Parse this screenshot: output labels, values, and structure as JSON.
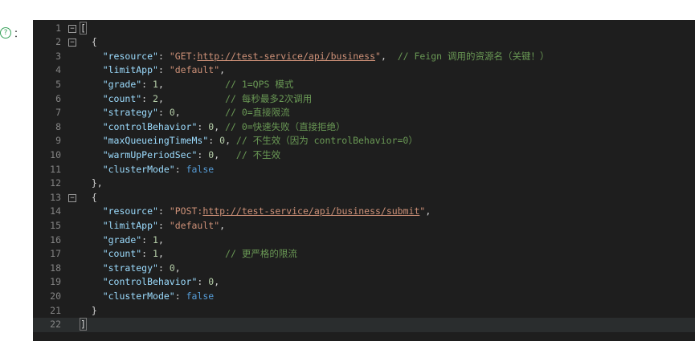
{
  "label": {
    "text": "："
  },
  "editor": {
    "lines": [
      {
        "n": "1",
        "fold": "⊟",
        "tokens": [
          {
            "t": "[",
            "c": "p bracket-box"
          }
        ]
      },
      {
        "n": "2",
        "fold": "⊟",
        "tokens": [
          {
            "t": "  {",
            "c": "p"
          }
        ]
      },
      {
        "n": "3",
        "tokens": [
          {
            "t": "    ",
            "c": "p"
          },
          {
            "t": "\"resource\"",
            "c": "k"
          },
          {
            "t": ": ",
            "c": "p"
          },
          {
            "t": "\"GET:",
            "c": "s"
          },
          {
            "t": "http://test-service/api/business",
            "c": "s u"
          },
          {
            "t": "\"",
            "c": "s"
          },
          {
            "t": ",  ",
            "c": "p"
          },
          {
            "t": "// Feign 调用的资源名（关键！）",
            "c": "c"
          }
        ]
      },
      {
        "n": "4",
        "tokens": [
          {
            "t": "    ",
            "c": "p"
          },
          {
            "t": "\"limitApp\"",
            "c": "k"
          },
          {
            "t": ": ",
            "c": "p"
          },
          {
            "t": "\"default\"",
            "c": "s"
          },
          {
            "t": ",",
            "c": "p"
          }
        ]
      },
      {
        "n": "5",
        "tokens": [
          {
            "t": "    ",
            "c": "p"
          },
          {
            "t": "\"grade\"",
            "c": "k"
          },
          {
            "t": ": ",
            "c": "p"
          },
          {
            "t": "1",
            "c": "n"
          },
          {
            "t": ",           ",
            "c": "p"
          },
          {
            "t": "// 1=QPS 模式",
            "c": "c"
          }
        ]
      },
      {
        "n": "6",
        "tokens": [
          {
            "t": "    ",
            "c": "p"
          },
          {
            "t": "\"count\"",
            "c": "k"
          },
          {
            "t": ": ",
            "c": "p"
          },
          {
            "t": "2",
            "c": "n"
          },
          {
            "t": ",           ",
            "c": "p"
          },
          {
            "t": "// 每秒最多2次调用",
            "c": "c"
          }
        ]
      },
      {
        "n": "7",
        "tokens": [
          {
            "t": "    ",
            "c": "p"
          },
          {
            "t": "\"strategy\"",
            "c": "k"
          },
          {
            "t": ": ",
            "c": "p"
          },
          {
            "t": "0",
            "c": "n"
          },
          {
            "t": ",        ",
            "c": "p"
          },
          {
            "t": "// 0=直接限流",
            "c": "c"
          }
        ]
      },
      {
        "n": "8",
        "tokens": [
          {
            "t": "    ",
            "c": "p"
          },
          {
            "t": "\"controlBehavior\"",
            "c": "k"
          },
          {
            "t": ": ",
            "c": "p"
          },
          {
            "t": "0",
            "c": "n"
          },
          {
            "t": ", ",
            "c": "p"
          },
          {
            "t": "// 0=快速失败（直接拒绝）",
            "c": "c"
          }
        ]
      },
      {
        "n": "9",
        "tokens": [
          {
            "t": "    ",
            "c": "p"
          },
          {
            "t": "\"maxQueueingTimeMs\"",
            "c": "k"
          },
          {
            "t": ": ",
            "c": "p"
          },
          {
            "t": "0",
            "c": "n"
          },
          {
            "t": ", ",
            "c": "p"
          },
          {
            "t": "// 不生效（因为 controlBehavior=0）",
            "c": "c"
          }
        ]
      },
      {
        "n": "10",
        "tokens": [
          {
            "t": "    ",
            "c": "p"
          },
          {
            "t": "\"warmUpPeriodSec\"",
            "c": "k"
          },
          {
            "t": ": ",
            "c": "p"
          },
          {
            "t": "0",
            "c": "n"
          },
          {
            "t": ",   ",
            "c": "p"
          },
          {
            "t": "// 不生效",
            "c": "c"
          }
        ]
      },
      {
        "n": "11",
        "tokens": [
          {
            "t": "    ",
            "c": "p"
          },
          {
            "t": "\"clusterMode\"",
            "c": "k"
          },
          {
            "t": ": ",
            "c": "p"
          },
          {
            "t": "false",
            "c": "b"
          }
        ]
      },
      {
        "n": "12",
        "tokens": [
          {
            "t": "  },",
            "c": "p"
          }
        ]
      },
      {
        "n": "13",
        "fold": "⊟",
        "tokens": [
          {
            "t": "  {",
            "c": "p"
          }
        ]
      },
      {
        "n": "14",
        "tokens": [
          {
            "t": "    ",
            "c": "p"
          },
          {
            "t": "\"resource\"",
            "c": "k"
          },
          {
            "t": ": ",
            "c": "p"
          },
          {
            "t": "\"POST:",
            "c": "s"
          },
          {
            "t": "http://test-service/api/business/submit",
            "c": "s u"
          },
          {
            "t": "\"",
            "c": "s"
          },
          {
            "t": ",",
            "c": "p"
          }
        ]
      },
      {
        "n": "15",
        "tokens": [
          {
            "t": "    ",
            "c": "p"
          },
          {
            "t": "\"limitApp\"",
            "c": "k"
          },
          {
            "t": ": ",
            "c": "p"
          },
          {
            "t": "\"default\"",
            "c": "s"
          },
          {
            "t": ",",
            "c": "p"
          }
        ]
      },
      {
        "n": "16",
        "tokens": [
          {
            "t": "    ",
            "c": "p"
          },
          {
            "t": "\"grade\"",
            "c": "k"
          },
          {
            "t": ": ",
            "c": "p"
          },
          {
            "t": "1",
            "c": "n"
          },
          {
            "t": ",",
            "c": "p"
          }
        ]
      },
      {
        "n": "17",
        "tokens": [
          {
            "t": "    ",
            "c": "p"
          },
          {
            "t": "\"count\"",
            "c": "k"
          },
          {
            "t": ": ",
            "c": "p"
          },
          {
            "t": "1",
            "c": "n"
          },
          {
            "t": ",           ",
            "c": "p"
          },
          {
            "t": "// 更严格的限流",
            "c": "c"
          }
        ]
      },
      {
        "n": "18",
        "tokens": [
          {
            "t": "    ",
            "c": "p"
          },
          {
            "t": "\"strategy\"",
            "c": "k"
          },
          {
            "t": ": ",
            "c": "p"
          },
          {
            "t": "0",
            "c": "n"
          },
          {
            "t": ",",
            "c": "p"
          }
        ]
      },
      {
        "n": "19",
        "tokens": [
          {
            "t": "    ",
            "c": "p"
          },
          {
            "t": "\"controlBehavior\"",
            "c": "k"
          },
          {
            "t": ": ",
            "c": "p"
          },
          {
            "t": "0",
            "c": "n"
          },
          {
            "t": ",",
            "c": "p"
          }
        ]
      },
      {
        "n": "20",
        "tokens": [
          {
            "t": "    ",
            "c": "p"
          },
          {
            "t": "\"clusterMode\"",
            "c": "k"
          },
          {
            "t": ": ",
            "c": "p"
          },
          {
            "t": "false",
            "c": "b"
          }
        ]
      },
      {
        "n": "21",
        "tokens": [
          {
            "t": "  }",
            "c": "p"
          }
        ]
      },
      {
        "n": "22",
        "current": true,
        "tokens": [
          {
            "t": "]",
            "c": "p bracket-box"
          }
        ]
      }
    ]
  }
}
